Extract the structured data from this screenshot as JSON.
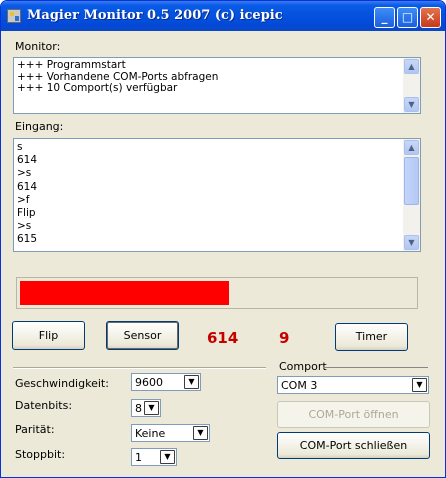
{
  "window": {
    "title": "Magier Monitor 0.5 2007 (c) icepic"
  },
  "titlebar_buttons": {
    "minimize": "_",
    "maximize": "□",
    "close": "✕"
  },
  "monitor": {
    "label": "Monitor:",
    "lines": "+++ Programmstart\n+++ Vorhandene COM-Ports abfragen\n+++ 10 Comport(s) verfügbar"
  },
  "eingang": {
    "label": "Eingang:",
    "lines": "s\n614\n>s\n614\n>f\nFlip\n>s\n615"
  },
  "progress": {
    "value": 0.53,
    "color": "#ff0000"
  },
  "buttons": {
    "flip": "Flip",
    "sensor": "Sensor",
    "timer": "Timer",
    "open_port": "COM-Port öffnen",
    "close_port": "COM-Port schließen"
  },
  "readouts": {
    "sensor_value": "614",
    "count": "9"
  },
  "settings": {
    "speed_label": "Geschwindigkeit:",
    "speed_value": "9600",
    "databits_label": "Datenbits:",
    "databits_value": "8",
    "parity_label": "Parität:",
    "parity_value": "Keine",
    "stopbits_label": "Stoppbit:",
    "stopbits_value": "1"
  },
  "comport": {
    "label": "Comport",
    "value": "COM 3"
  },
  "icons": {
    "dropdown": "chevron-down-icon",
    "scroll_up": "▲",
    "scroll_down": "▼"
  }
}
